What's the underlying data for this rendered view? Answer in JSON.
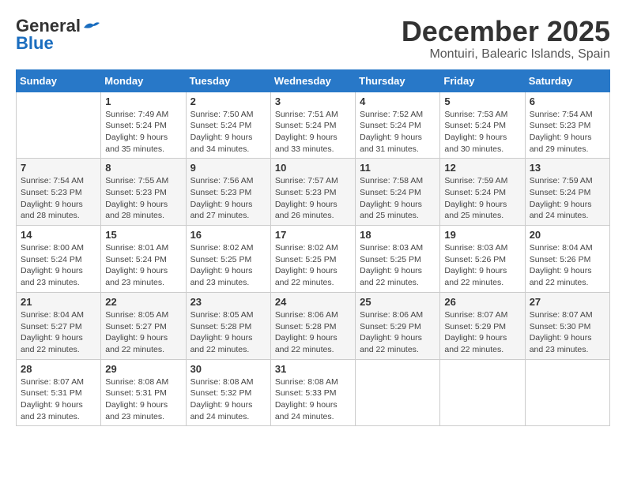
{
  "logo": {
    "general": "General",
    "blue": "Blue"
  },
  "title": "December 2025",
  "location": "Montuiri, Balearic Islands, Spain",
  "weekdays": [
    "Sunday",
    "Monday",
    "Tuesday",
    "Wednesday",
    "Thursday",
    "Friday",
    "Saturday"
  ],
  "weeks": [
    [
      {
        "day": "",
        "info": ""
      },
      {
        "day": "1",
        "info": "Sunrise: 7:49 AM\nSunset: 5:24 PM\nDaylight: 9 hours\nand 35 minutes."
      },
      {
        "day": "2",
        "info": "Sunrise: 7:50 AM\nSunset: 5:24 PM\nDaylight: 9 hours\nand 34 minutes."
      },
      {
        "day": "3",
        "info": "Sunrise: 7:51 AM\nSunset: 5:24 PM\nDaylight: 9 hours\nand 33 minutes."
      },
      {
        "day": "4",
        "info": "Sunrise: 7:52 AM\nSunset: 5:24 PM\nDaylight: 9 hours\nand 31 minutes."
      },
      {
        "day": "5",
        "info": "Sunrise: 7:53 AM\nSunset: 5:24 PM\nDaylight: 9 hours\nand 30 minutes."
      },
      {
        "day": "6",
        "info": "Sunrise: 7:54 AM\nSunset: 5:23 PM\nDaylight: 9 hours\nand 29 minutes."
      }
    ],
    [
      {
        "day": "7",
        "info": "Sunrise: 7:54 AM\nSunset: 5:23 PM\nDaylight: 9 hours\nand 28 minutes."
      },
      {
        "day": "8",
        "info": "Sunrise: 7:55 AM\nSunset: 5:23 PM\nDaylight: 9 hours\nand 28 minutes."
      },
      {
        "day": "9",
        "info": "Sunrise: 7:56 AM\nSunset: 5:23 PM\nDaylight: 9 hours\nand 27 minutes."
      },
      {
        "day": "10",
        "info": "Sunrise: 7:57 AM\nSunset: 5:23 PM\nDaylight: 9 hours\nand 26 minutes."
      },
      {
        "day": "11",
        "info": "Sunrise: 7:58 AM\nSunset: 5:24 PM\nDaylight: 9 hours\nand 25 minutes."
      },
      {
        "day": "12",
        "info": "Sunrise: 7:59 AM\nSunset: 5:24 PM\nDaylight: 9 hours\nand 25 minutes."
      },
      {
        "day": "13",
        "info": "Sunrise: 7:59 AM\nSunset: 5:24 PM\nDaylight: 9 hours\nand 24 minutes."
      }
    ],
    [
      {
        "day": "14",
        "info": "Sunrise: 8:00 AM\nSunset: 5:24 PM\nDaylight: 9 hours\nand 23 minutes."
      },
      {
        "day": "15",
        "info": "Sunrise: 8:01 AM\nSunset: 5:24 PM\nDaylight: 9 hours\nand 23 minutes."
      },
      {
        "day": "16",
        "info": "Sunrise: 8:02 AM\nSunset: 5:25 PM\nDaylight: 9 hours\nand 23 minutes."
      },
      {
        "day": "17",
        "info": "Sunrise: 8:02 AM\nSunset: 5:25 PM\nDaylight: 9 hours\nand 22 minutes."
      },
      {
        "day": "18",
        "info": "Sunrise: 8:03 AM\nSunset: 5:25 PM\nDaylight: 9 hours\nand 22 minutes."
      },
      {
        "day": "19",
        "info": "Sunrise: 8:03 AM\nSunset: 5:26 PM\nDaylight: 9 hours\nand 22 minutes."
      },
      {
        "day": "20",
        "info": "Sunrise: 8:04 AM\nSunset: 5:26 PM\nDaylight: 9 hours\nand 22 minutes."
      }
    ],
    [
      {
        "day": "21",
        "info": "Sunrise: 8:04 AM\nSunset: 5:27 PM\nDaylight: 9 hours\nand 22 minutes."
      },
      {
        "day": "22",
        "info": "Sunrise: 8:05 AM\nSunset: 5:27 PM\nDaylight: 9 hours\nand 22 minutes."
      },
      {
        "day": "23",
        "info": "Sunrise: 8:05 AM\nSunset: 5:28 PM\nDaylight: 9 hours\nand 22 minutes."
      },
      {
        "day": "24",
        "info": "Sunrise: 8:06 AM\nSunset: 5:28 PM\nDaylight: 9 hours\nand 22 minutes."
      },
      {
        "day": "25",
        "info": "Sunrise: 8:06 AM\nSunset: 5:29 PM\nDaylight: 9 hours\nand 22 minutes."
      },
      {
        "day": "26",
        "info": "Sunrise: 8:07 AM\nSunset: 5:29 PM\nDaylight: 9 hours\nand 22 minutes."
      },
      {
        "day": "27",
        "info": "Sunrise: 8:07 AM\nSunset: 5:30 PM\nDaylight: 9 hours\nand 23 minutes."
      }
    ],
    [
      {
        "day": "28",
        "info": "Sunrise: 8:07 AM\nSunset: 5:31 PM\nDaylight: 9 hours\nand 23 minutes."
      },
      {
        "day": "29",
        "info": "Sunrise: 8:08 AM\nSunset: 5:31 PM\nDaylight: 9 hours\nand 23 minutes."
      },
      {
        "day": "30",
        "info": "Sunrise: 8:08 AM\nSunset: 5:32 PM\nDaylight: 9 hours\nand 24 minutes."
      },
      {
        "day": "31",
        "info": "Sunrise: 8:08 AM\nSunset: 5:33 PM\nDaylight: 9 hours\nand 24 minutes."
      },
      {
        "day": "",
        "info": ""
      },
      {
        "day": "",
        "info": ""
      },
      {
        "day": "",
        "info": ""
      }
    ]
  ]
}
